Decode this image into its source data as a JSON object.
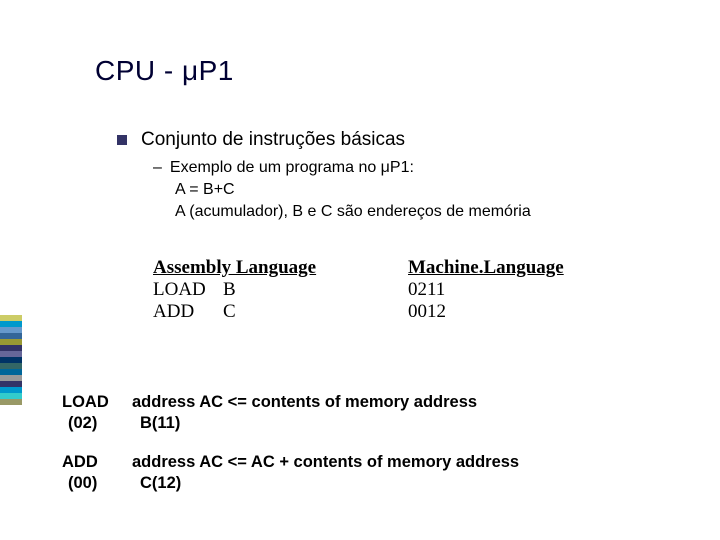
{
  "stripes": [
    "#cccc66",
    "#0099cc",
    "#6699cc",
    "#336699",
    "#999933",
    "#333366",
    "#666699",
    "#003366",
    "#336666",
    "#006699",
    "#999999",
    "#333366",
    "#0099cc",
    "#33cccc",
    "#999966"
  ],
  "title": "CPU - μP1",
  "bullet": "Conjunto de  instruções básicas",
  "sub1": "Exemplo de um programa no μP1:",
  "sub2": "A = B+C",
  "sub3": "A (acumulador), B e C são endereços de memória",
  "table": {
    "head1": "Assembly Language",
    "head2": "Machine.Language",
    "rows": [
      {
        "op": "LOAD",
        "arg": "B",
        "mc": "0211"
      },
      {
        "op": "ADD",
        "arg": "C",
        "mc": "0012"
      }
    ]
  },
  "defs": [
    {
      "l1": "LOAD",
      "l2": "(02)",
      "r1": "address AC <= contents of memory address",
      "r2": "B(11)"
    },
    {
      "l1": "ADD",
      "l2": "(00)",
      "r1": "address AC <= AC + contents of memory address",
      "r2": "C(12)"
    }
  ]
}
